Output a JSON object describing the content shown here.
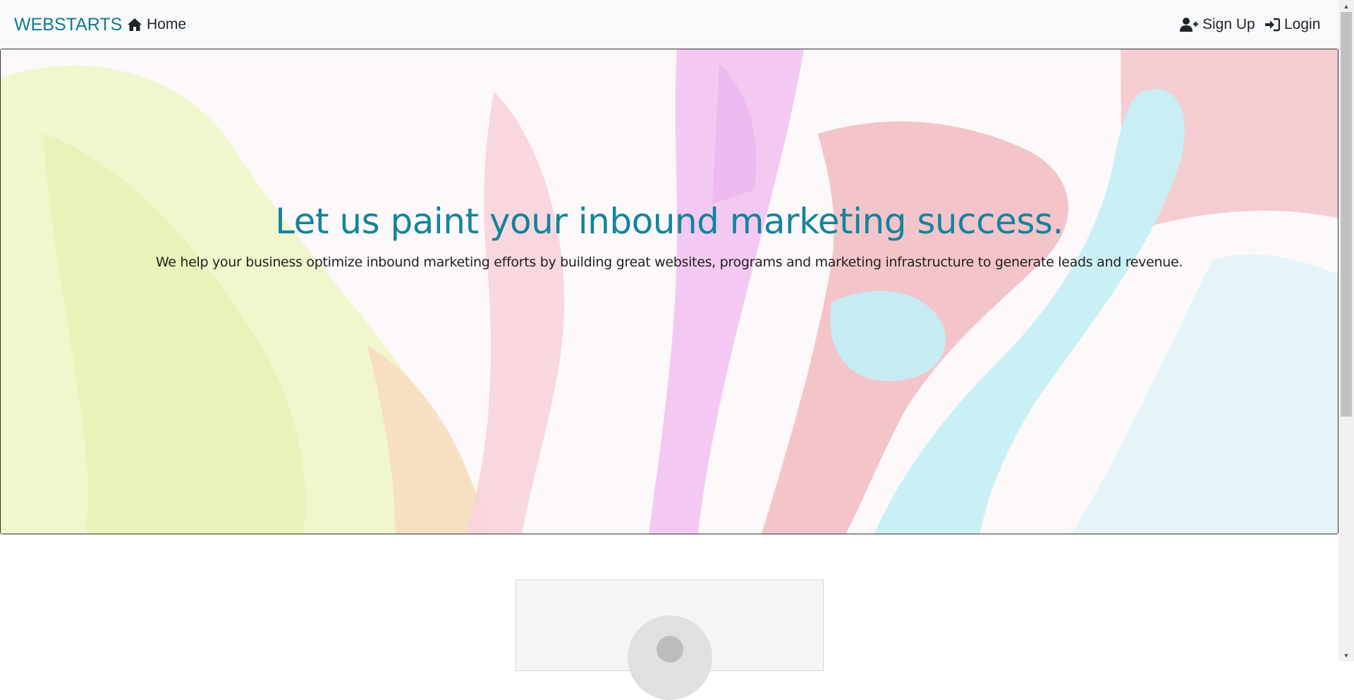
{
  "navbar": {
    "brand": "WEBSTARTS",
    "home_label": "Home",
    "signup_label": "Sign Up",
    "login_label": "Login"
  },
  "hero": {
    "title": "Let us paint your inbound marketing success.",
    "subtitle": "We help your business optimize inbound marketing efforts by building great websites, programs and marketing infrastructure to generate leads and revenue."
  },
  "icons": {
    "home": "home-icon",
    "signup": "user-plus-icon",
    "login": "sign-in-icon",
    "avatar": "user-placeholder-icon"
  },
  "colors": {
    "brand": "#117a8b",
    "title": "#13849e",
    "navbar_bg": "#f8f9fa"
  }
}
